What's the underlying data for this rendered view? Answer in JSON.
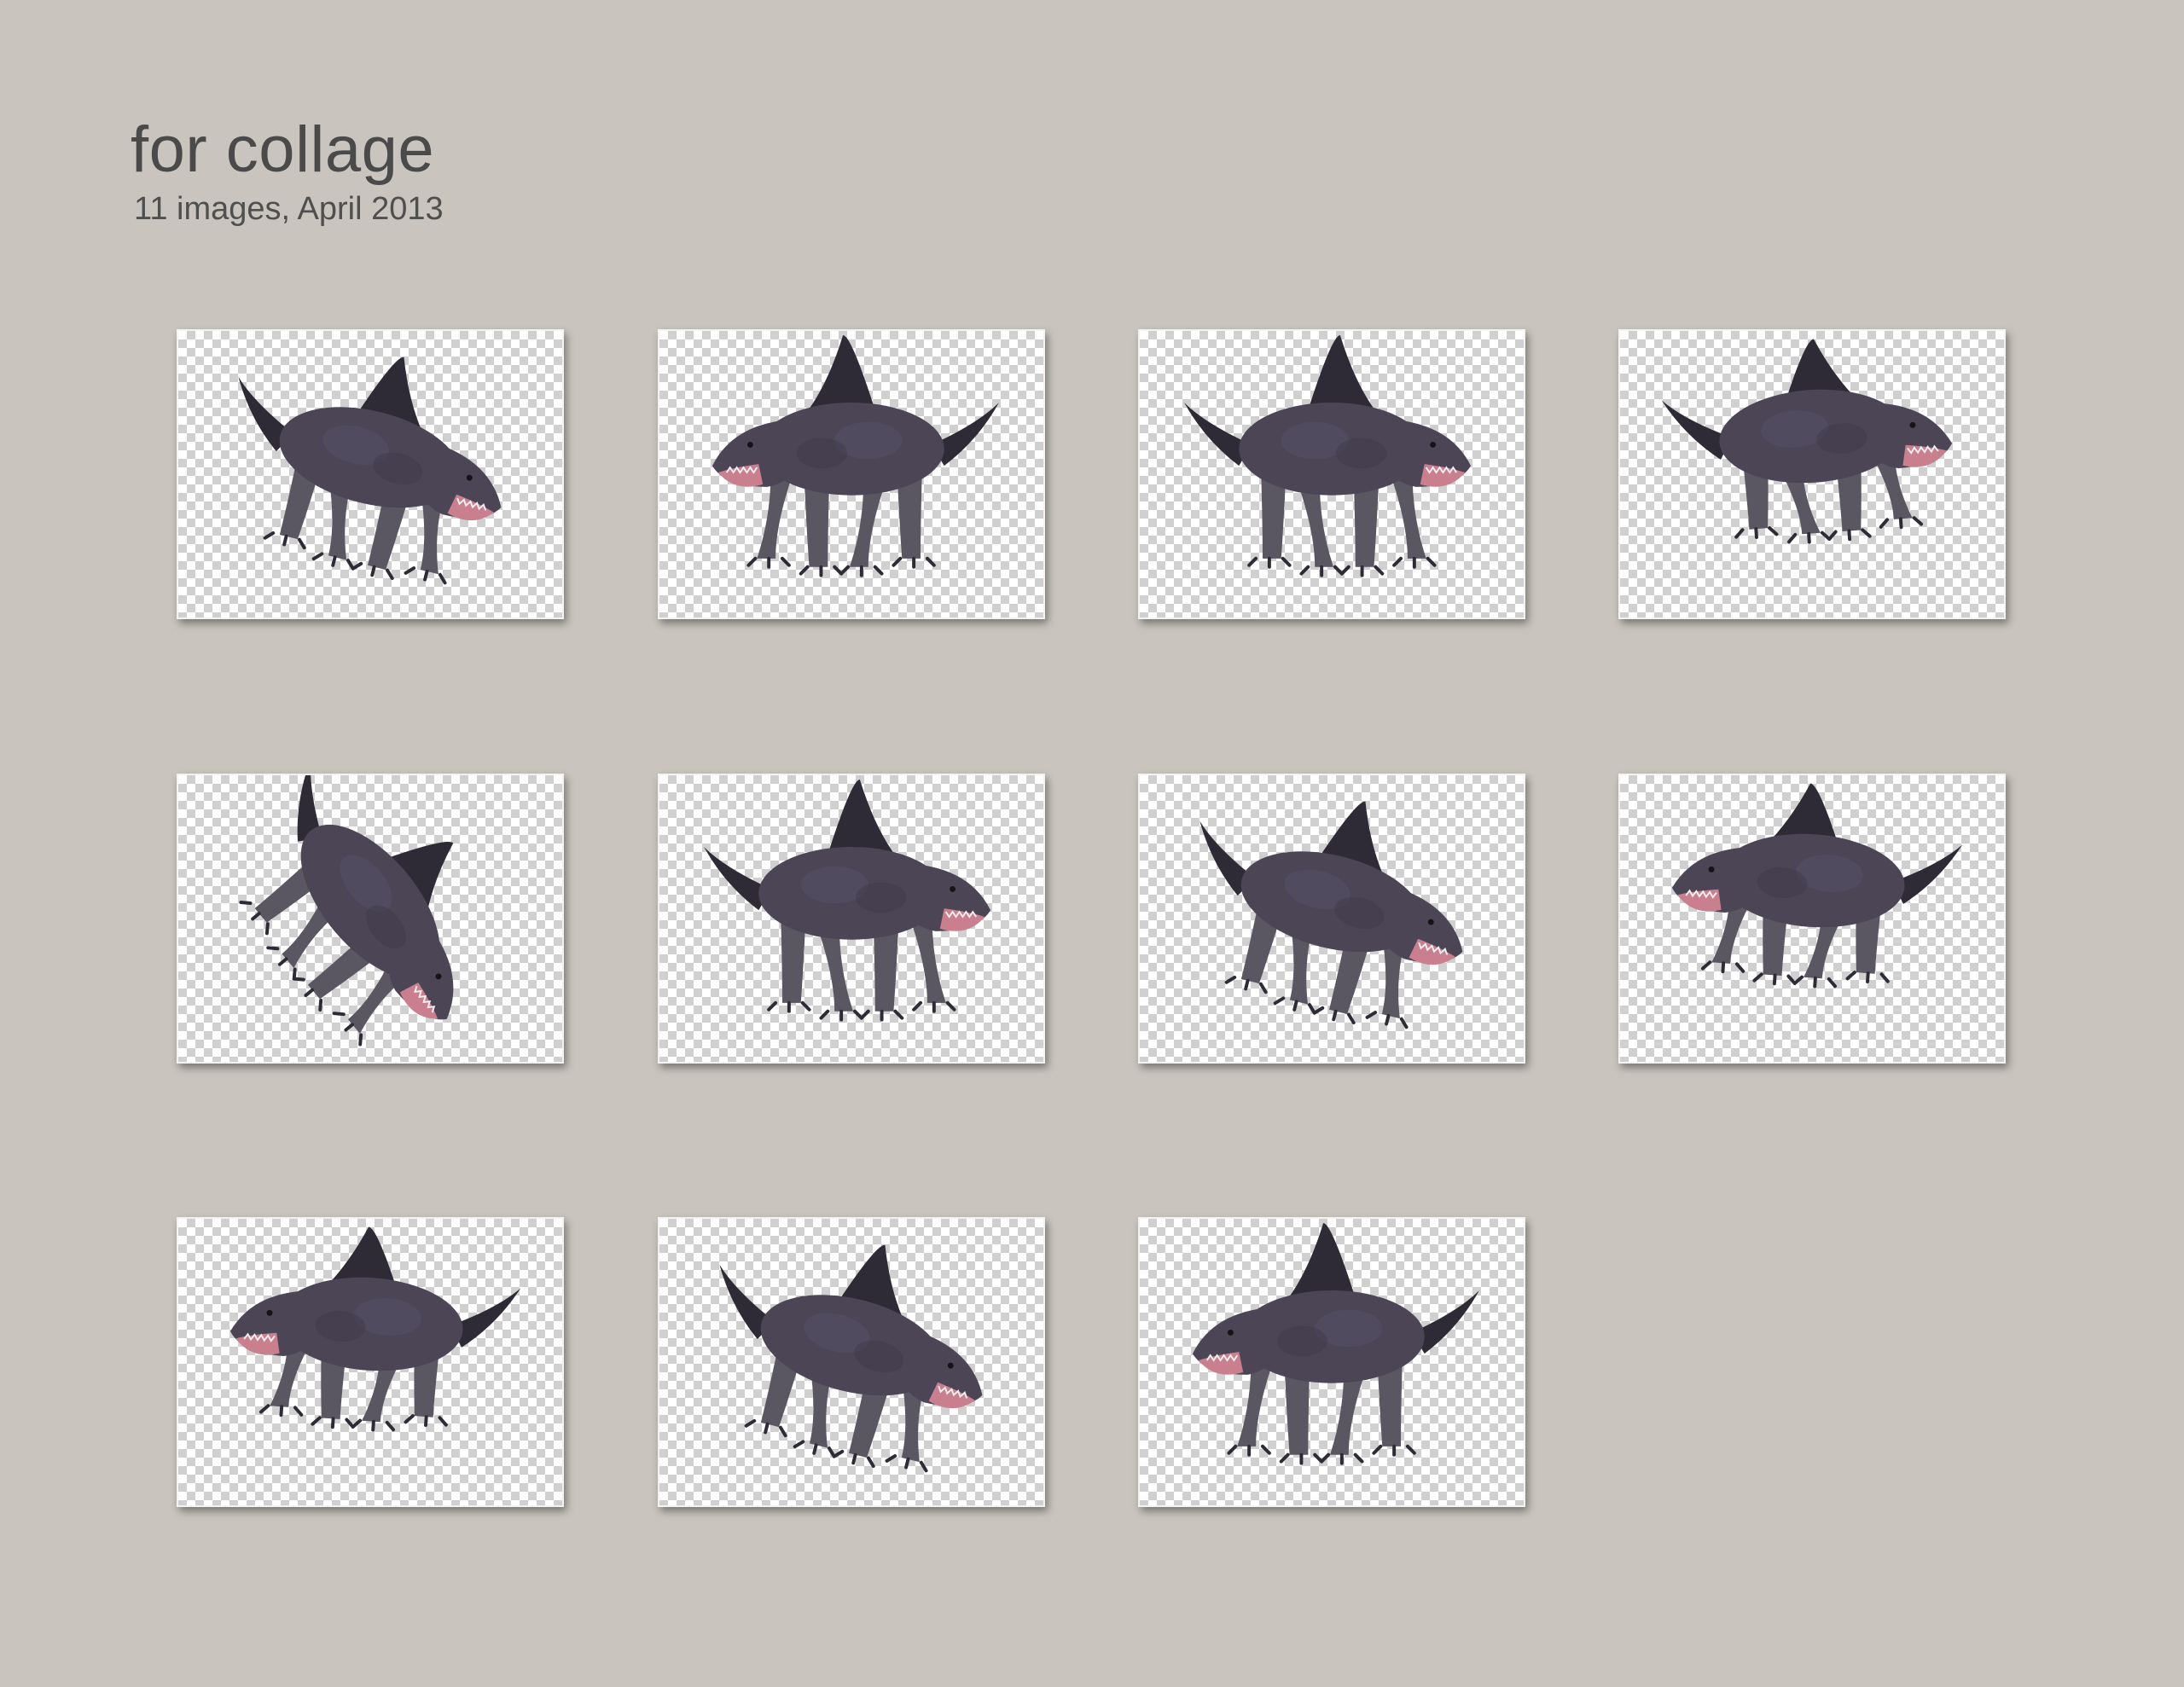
{
  "album": {
    "title": "for collage",
    "subtitle": "11 images, April 2013"
  },
  "colors": {
    "background": "#c9c5be",
    "creature_body": "#4b4556",
    "creature_dark": "#2f2b36",
    "creature_mouth": "#c97f8e",
    "checker_light": "#ffffff",
    "checker_dark": "#d0d0d0"
  },
  "thumbnails": [
    {
      "name": "shark-creature-1",
      "icon": "shark-creature-icon",
      "facing": "right",
      "pose": "crouch"
    },
    {
      "name": "shark-creature-2",
      "icon": "shark-creature-icon",
      "facing": "left",
      "pose": "stand"
    },
    {
      "name": "shark-creature-3",
      "icon": "shark-creature-icon",
      "facing": "right",
      "pose": "stand"
    },
    {
      "name": "shark-creature-4",
      "icon": "shark-creature-icon",
      "facing": "right",
      "pose": "leap"
    },
    {
      "name": "shark-creature-5",
      "icon": "shark-creature-icon",
      "facing": "down",
      "pose": "dive"
    },
    {
      "name": "shark-creature-6",
      "icon": "shark-creature-icon",
      "facing": "right",
      "pose": "stand"
    },
    {
      "name": "shark-creature-7",
      "icon": "shark-creature-icon",
      "facing": "right",
      "pose": "crouch"
    },
    {
      "name": "shark-creature-8",
      "icon": "shark-creature-icon",
      "facing": "left",
      "pose": "leap"
    },
    {
      "name": "shark-creature-9",
      "icon": "shark-creature-icon",
      "facing": "left",
      "pose": "leap"
    },
    {
      "name": "shark-creature-10",
      "icon": "shark-creature-icon",
      "facing": "front",
      "pose": "crouch"
    },
    {
      "name": "shark-creature-11",
      "icon": "shark-creature-icon",
      "facing": "left",
      "pose": "stand"
    }
  ]
}
